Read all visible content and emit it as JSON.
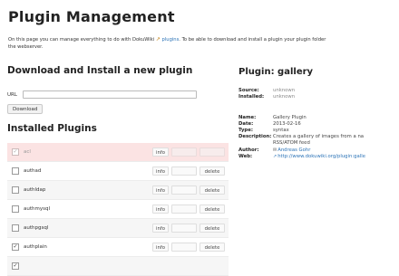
{
  "title": "Plugin Management",
  "intro": {
    "line1_before": "On this page you can manage everything to do with DokuWiki",
    "link": "plugins",
    "line1_after": ". To be able to download and install a plugin your plugin folder",
    "line2": "the webserver."
  },
  "download": {
    "heading": "Download and Install a new plugin",
    "url_label": "URL",
    "url_value": "",
    "button": "Download"
  },
  "installed": {
    "heading": "Installed Plugins",
    "info_label": "info",
    "delete_label": "delete",
    "plugins": [
      {
        "name": "acl",
        "checked": true,
        "disabled": true
      },
      {
        "name": "authad",
        "checked": false,
        "disabled": false
      },
      {
        "name": "authldap",
        "checked": false,
        "disabled": false
      },
      {
        "name": "authmysql",
        "checked": false,
        "disabled": false
      },
      {
        "name": "authpgsql",
        "checked": false,
        "disabled": false
      },
      {
        "name": "authplain",
        "checked": true,
        "disabled": false
      }
    ]
  },
  "plugin_info": {
    "heading": "Plugin: gallery",
    "source_label": "Source:",
    "source_value": "unknown",
    "installed_label": "Installed:",
    "installed_value": "unknown",
    "name_label": "Name:",
    "name_value": "Gallery Plugin",
    "date_label": "Date:",
    "date_value": "2013-02-16",
    "type_label": "Type:",
    "type_value": "syntax",
    "description_label": "Description:",
    "description_line1": "Creates a gallery of images from a na",
    "description_line2": "RSS/ATOM feed",
    "author_label": "Author:",
    "author_value": "Andreas Gohr",
    "web_label": "Web:",
    "web_value": "http://www.dokuwiki.org/plugin:galle"
  }
}
